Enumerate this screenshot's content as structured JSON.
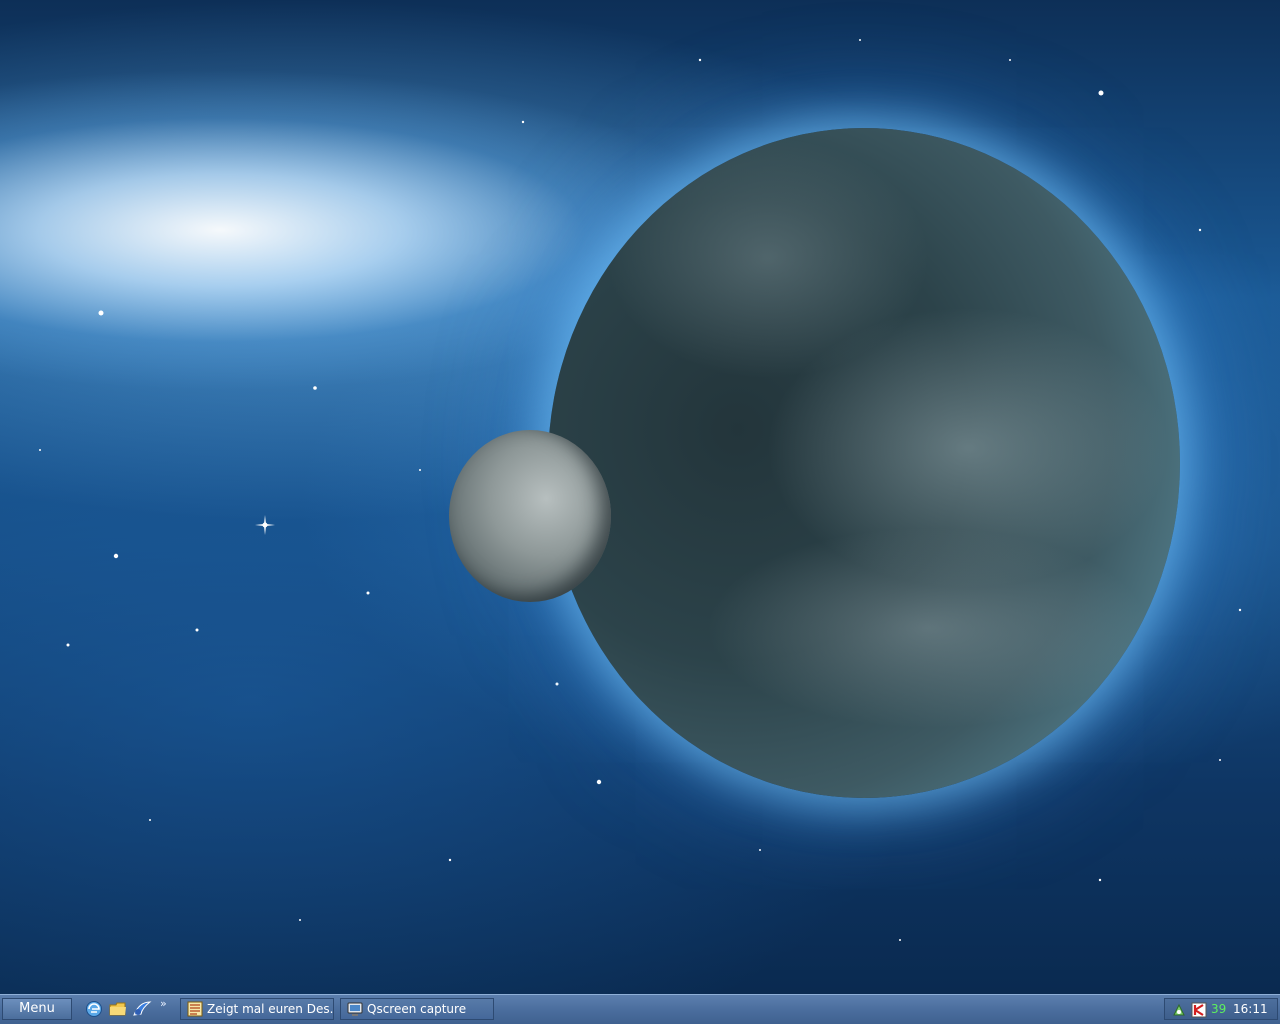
{
  "desktop": {
    "wallpaper": "space-planet-moon"
  },
  "taskbar": {
    "menu_label": "Menu",
    "quick_launch": [
      {
        "icon": "browser-icon"
      },
      {
        "icon": "folder-icon"
      },
      {
        "icon": "mail-icon"
      }
    ],
    "more_label": "»",
    "tasks": [
      {
        "label": "Zeigt mal euren Des...",
        "icon": "web-page-icon"
      },
      {
        "label": "Qscreen capture",
        "icon": "screen-capture-icon"
      }
    ]
  },
  "tray": {
    "count": "39",
    "clock": "16:11",
    "icons": [
      "network-icon",
      "antivirus-icon"
    ]
  },
  "colors": {
    "taskbar": "#4b6e9e",
    "tray_count": "#5ef05e"
  }
}
